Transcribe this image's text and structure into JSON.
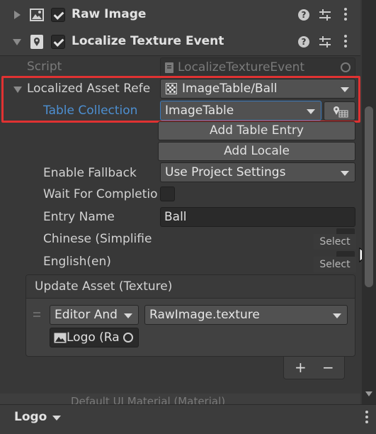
{
  "components": {
    "raw_image": {
      "title": "Raw Image",
      "enabled": true
    },
    "localize_texture_event": {
      "title": "Localize Texture Event",
      "enabled": true
    }
  },
  "script": {
    "label": "Script",
    "value": "LocalizeTextureEvent"
  },
  "localized_asset_reference": {
    "label": "Localized Asset Refe",
    "value": "ImageTable/Ball"
  },
  "table_collection": {
    "label": "Table Collection",
    "value": "ImageTable"
  },
  "buttons": {
    "add_table_entry": "Add Table Entry",
    "add_locale": "Add Locale"
  },
  "enable_fallback": {
    "label": "Enable Fallback",
    "value": "Use Project Settings"
  },
  "wait_for_completion": {
    "label": "Wait For Completio",
    "checked": false
  },
  "entry_name": {
    "label": "Entry Name",
    "value": "Ball"
  },
  "locales": [
    {
      "label": "Chinese (Simplifie",
      "button": "Select"
    },
    {
      "label": "English(en)",
      "button": "Select"
    }
  ],
  "update_asset": {
    "header": "Update Asset (Texture)",
    "runtime": "Editor And",
    "function": "RawImage.texture",
    "object": "Logo (Ra",
    "add": "+",
    "remove": "−"
  },
  "footer": {
    "partial_text": "Default UI Material (Material)",
    "object_label": "Logo"
  },
  "colors": {
    "highlight_border": "#e03232",
    "label_blue": "#4d8fd1",
    "background": "#383838"
  },
  "icons": [
    "image-icon",
    "location-pin-icon",
    "help-icon",
    "sliders-icon",
    "more-icon",
    "asset-icon",
    "table-picker-icon",
    "object-picker-icon",
    "texture-icon",
    "mouse-cursor-icon"
  ]
}
